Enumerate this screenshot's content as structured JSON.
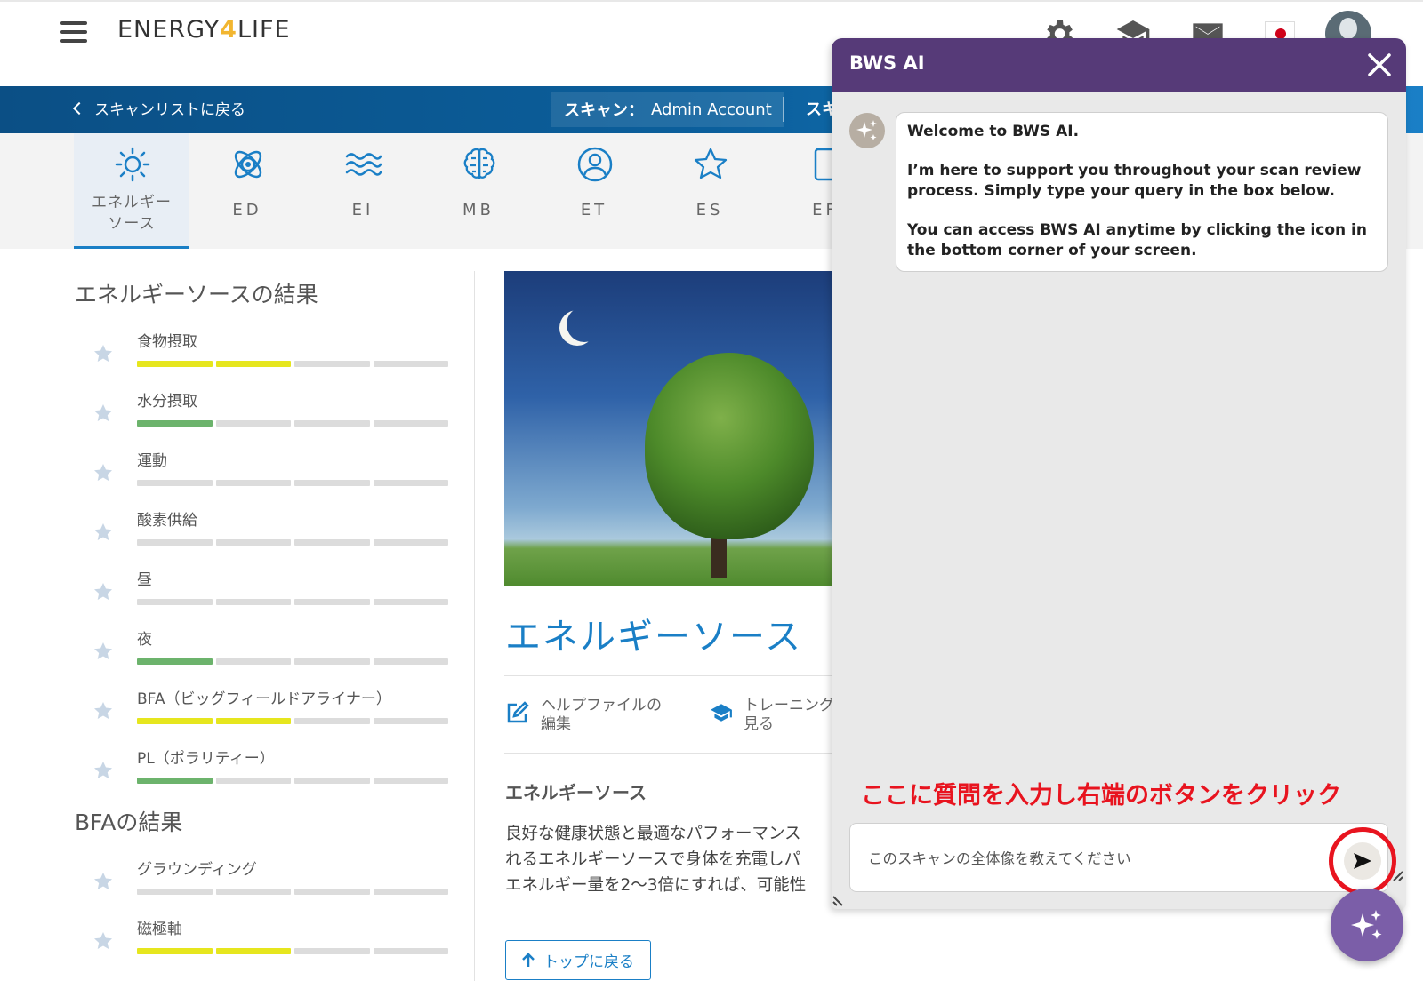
{
  "header": {
    "logo_prefix": "ENERGY",
    "logo_four": "4",
    "logo_suffix": "LIFE",
    "icons": [
      "gear-icon",
      "graduation-cap-icon",
      "mail-icon",
      "flag-japan-icon",
      "avatar"
    ]
  },
  "bluebar": {
    "back_label": "スキャンリストに戻る",
    "scan_label": "スキャン：",
    "scan_value": "Admin Account",
    "scan2_label": "スキ"
  },
  "tabs": [
    {
      "label": "エネルギー\nソース",
      "icon": "sun-icon",
      "active": true
    },
    {
      "label": "ED",
      "icon": "atom-icon"
    },
    {
      "label": "EI",
      "icon": "waves-icon"
    },
    {
      "label": "MB",
      "icon": "brain-icon"
    },
    {
      "label": "ET",
      "icon": "person-circle-icon"
    },
    {
      "label": "ES",
      "icon": "star-outline-icon"
    },
    {
      "label": "EF",
      "icon": "tablet-icon"
    }
  ],
  "results": {
    "title": "エネルギーソースの結果",
    "items": [
      {
        "label": "食物摂取",
        "level": 2,
        "color": "#e6e61e"
      },
      {
        "label": "水分摂取",
        "level": 1,
        "color": "#6cb36c"
      },
      {
        "label": "運動",
        "level": 0,
        "color": "#dcdcdc"
      },
      {
        "label": "酸素供給",
        "level": 0,
        "color": "#dcdcdc"
      },
      {
        "label": "昼",
        "level": 0,
        "color": "#dcdcdc"
      },
      {
        "label": "夜",
        "level": 1,
        "color": "#6cb36c"
      },
      {
        "label": "BFA（ビッグフィールドアライナー）",
        "level": 2,
        "color": "#e6e61e"
      },
      {
        "label": "PL（ポラリティー）",
        "level": 1,
        "color": "#6cb36c"
      }
    ]
  },
  "bfa": {
    "title": "BFAの結果",
    "items": [
      {
        "label": "グラウンディング",
        "level": 0,
        "color": "#dcdcdc"
      },
      {
        "label": "磁極軸",
        "level": 2,
        "color": "#e6e61e"
      }
    ]
  },
  "main": {
    "title": "エネルギーソース",
    "help_line1": "ヘルプファイルの",
    "help_line2": "編集",
    "training_line1": "トレーニング",
    "training_line2": "見る",
    "sub_heading": "エネルギーソース",
    "body_line1": "良好な健康状態と最適なパフォーマンス",
    "body_line2": "れるエネルギーソースで身体を充電しパ",
    "body_line3": "エネルギー量を2〜3倍にすれば、可能性",
    "back_top": "トップに戻る"
  },
  "chat": {
    "title": "BWS AI",
    "welcome": "Welcome to BWS AI.",
    "para1": "I’m here to support you throughout your scan review process. Simply type your query in the box below.",
    "para2": "You can access BWS AI anytime by clicking the icon in the bottom corner of your screen.",
    "instruction": "ここに質問を入力し右端のボタンをクリック",
    "input_value": "このスキャンの全体像を教えてください"
  },
  "colors": {
    "accent_blue": "#1a7fc6",
    "chat_header": "#563a78",
    "fab": "#7b5ea8",
    "highlight_red": "#e8141f",
    "bar_yellow": "#e6e61e",
    "bar_green": "#6cb36c"
  }
}
